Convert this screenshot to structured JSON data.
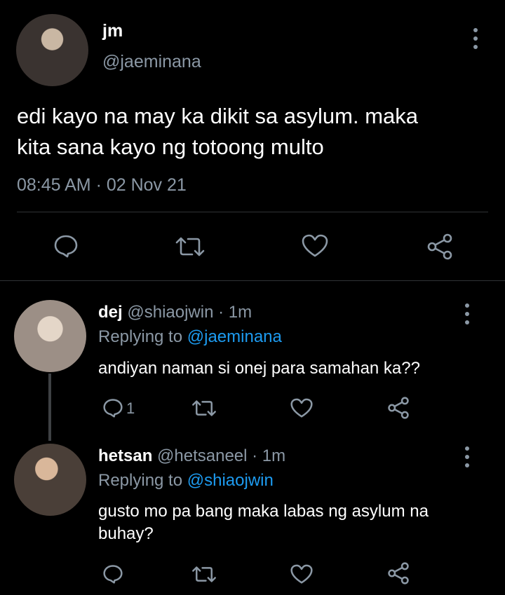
{
  "main_tweet": {
    "display_name": "jm",
    "handle": "@jaeminana",
    "text_line1": "edi kayo na may ka dikit sa asylum. maka",
    "text_line2": "kita sana kayo ng totoong multo",
    "timestamp": "08:45 AM · 02 Nov 21"
  },
  "replies": [
    {
      "display_name": "dej",
      "handle_time": "@shiaojwin · 1m",
      "replying_prefix": "Replying to",
      "replying_to": "@jaeminana",
      "text": "andiyan naman si onej para samahan ka??",
      "reply_count": "1"
    },
    {
      "display_name": "hetsan",
      "handle_time": "@hetsaneel · 1m",
      "replying_prefix": "Replying to",
      "replying_to": "@shiaojwin",
      "text_line1": "gusto mo pa bang maka labas ng asylum na",
      "text_line2": "buhay?"
    }
  ],
  "colors": {
    "background": "#000000",
    "text": "#e7e9ea",
    "muted": "#8b98a5",
    "link": "#1d9bf0",
    "divider": "#2f3336"
  },
  "icons": [
    "reply-icon",
    "retweet-icon",
    "like-icon",
    "share-icon",
    "more-options-icon"
  ]
}
